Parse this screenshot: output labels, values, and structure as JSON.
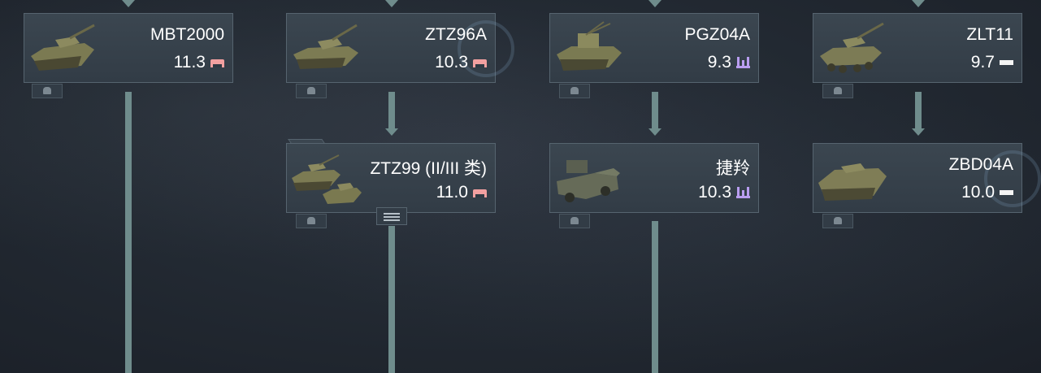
{
  "vehicles": {
    "mbt2000": {
      "name": "MBT2000",
      "br": "11.3",
      "role": "heavy-tank"
    },
    "ztz96a": {
      "name": "ZTZ96A",
      "br": "10.3",
      "role": "heavy-tank"
    },
    "pgz04a": {
      "name": "PGZ04A",
      "br": "9.3",
      "role": "spaa"
    },
    "zlt11": {
      "name": "ZLT11",
      "br": "9.7",
      "role": "light-tank"
    },
    "ztz99": {
      "name": "ZTZ99 (II/III 类)",
      "br": "11.0",
      "role": "heavy-tank"
    },
    "jieling": {
      "name": "捷羚",
      "br": "10.3",
      "role": "spaa"
    },
    "zbd04a": {
      "name": "ZBD04A",
      "br": "10.0",
      "role": "light-tank"
    }
  },
  "colors": {
    "heavy": "#f2a0a0",
    "spaa": "#b99df0",
    "light": "#f4f4f4",
    "connector": "#6f8c8c"
  }
}
